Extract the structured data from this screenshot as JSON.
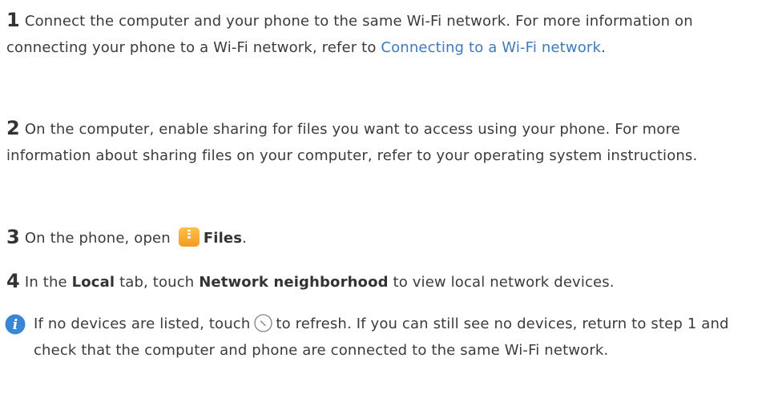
{
  "steps": [
    {
      "number": "1",
      "text_before": "Connect the computer and your phone to the same Wi-Fi network. For more information on connecting your phone to a Wi-Fi network, refer to ",
      "link": "Connecting to a Wi-Fi network",
      "text_after": "."
    },
    {
      "number": "2",
      "text": "On the computer, enable sharing for files you want to access using your phone. For more information about sharing files on your computer, refer to your operating system instructions."
    },
    {
      "number": "3",
      "text_before": "On the phone, open",
      "app_name": "Files",
      "text_after": ".",
      "icon": "files-app-icon"
    },
    {
      "number": "4",
      "text_1": "In the ",
      "bold_1": "Local",
      "text_2": " tab, touch ",
      "bold_2": "Network neighborhood",
      "text_3": " to view local network devices."
    }
  ],
  "note": {
    "icon": "info-icon",
    "text_before": "If no devices are listed, touch",
    "refresh_icon": "refresh-icon",
    "text_after": "to refresh. If you can still see no devices, return to step 1 and check that the computer and phone are connected to the same Wi-Fi network."
  },
  "colors": {
    "link": "#3f79bd",
    "note_icon": "#3a86d6",
    "files_icon": "#f5a623"
  }
}
